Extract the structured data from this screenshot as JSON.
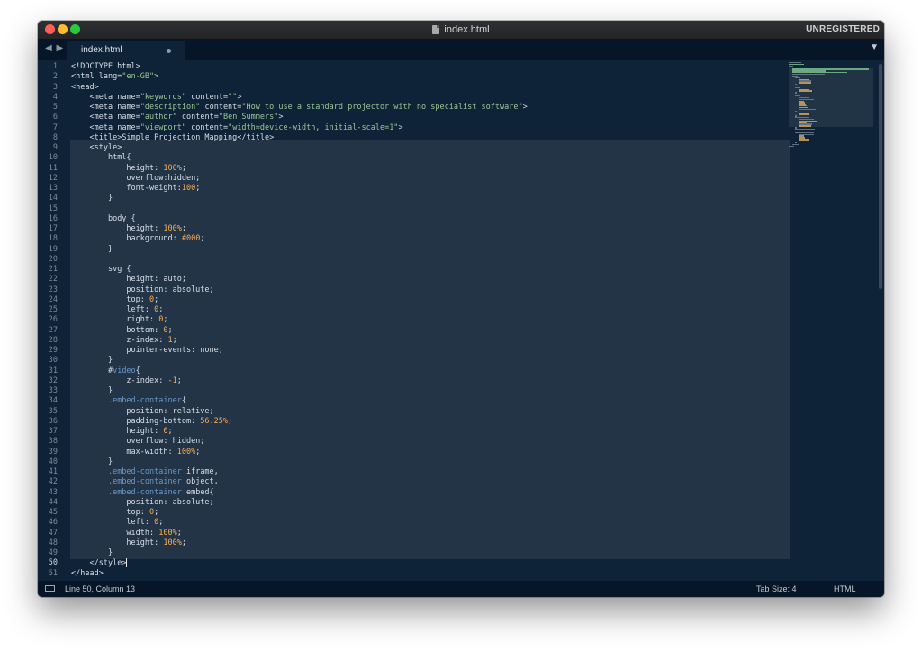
{
  "window": {
    "title": "index.html",
    "registration_status": "UNREGISTERED"
  },
  "tabs": [
    {
      "label": "index.html",
      "dirty": true
    }
  ],
  "icons": {
    "close": "close-icon",
    "minimize": "minimize-icon",
    "maximize": "maximize-icon",
    "document": "document-icon",
    "nav_arrows": "navigation-arrows-icon",
    "tab_menu": "chevron-down-icon",
    "panel": "panel-toggle-icon"
  },
  "nav_arrows": "◀ ▶",
  "tab_menu_glyph": "▼",
  "editor": {
    "active_line": 50,
    "lines": [
      [
        [
          "tag",
          "<!DOCTYPE html>"
        ]
      ],
      [
        [
          "tag",
          "<html "
        ],
        [
          "attr",
          "lang"
        ],
        [
          "tag",
          "="
        ],
        [
          "val",
          "\"en-GB\""
        ],
        [
          "tag",
          ">"
        ]
      ],
      [
        [
          "tag",
          "<head>"
        ]
      ],
      [
        [
          "text",
          "    "
        ],
        [
          "tag",
          "<meta "
        ],
        [
          "attr",
          "name"
        ],
        [
          "tag",
          "="
        ],
        [
          "val",
          "\"keywords\""
        ],
        [
          "tag",
          " "
        ],
        [
          "attr",
          "content"
        ],
        [
          "tag",
          "="
        ],
        [
          "val",
          "\"\""
        ],
        [
          "tag",
          ">"
        ]
      ],
      [
        [
          "text",
          "    "
        ],
        [
          "tag",
          "<meta "
        ],
        [
          "attr",
          "name"
        ],
        [
          "tag",
          "="
        ],
        [
          "val",
          "\"description\""
        ],
        [
          "tag",
          " "
        ],
        [
          "attr",
          "content"
        ],
        [
          "tag",
          "="
        ],
        [
          "val",
          "\"How to use a standard projector with no specialist software\""
        ],
        [
          "tag",
          ">"
        ]
      ],
      [
        [
          "text",
          "    "
        ],
        [
          "tag",
          "<meta "
        ],
        [
          "attr",
          "name"
        ],
        [
          "tag",
          "="
        ],
        [
          "val",
          "\"author\""
        ],
        [
          "tag",
          " "
        ],
        [
          "attr",
          "content"
        ],
        [
          "tag",
          "="
        ],
        [
          "val",
          "\"Ben Summers\""
        ],
        [
          "tag",
          ">"
        ]
      ],
      [
        [
          "text",
          "    "
        ],
        [
          "tag",
          "<meta "
        ],
        [
          "attr",
          "name"
        ],
        [
          "tag",
          "="
        ],
        [
          "val",
          "\"viewport\""
        ],
        [
          "tag",
          " "
        ],
        [
          "attr",
          "content"
        ],
        [
          "tag",
          "="
        ],
        [
          "val",
          "\"width=device-width, initial-scale=1\""
        ],
        [
          "tag",
          ">"
        ]
      ],
      [
        [
          "text",
          "    "
        ],
        [
          "tag",
          "<title>"
        ],
        [
          "text",
          "Simple Projection Mapping"
        ],
        [
          "tag",
          "</title>"
        ]
      ],
      [
        [
          "text",
          "    "
        ],
        [
          "tag",
          "<style>"
        ]
      ],
      [
        [
          "text",
          "        "
        ],
        [
          "prop",
          "html{"
        ]
      ],
      [
        [
          "text",
          "            "
        ],
        [
          "prop",
          "height: "
        ],
        [
          "num",
          "100%"
        ],
        [
          "prop",
          ";"
        ]
      ],
      [
        [
          "text",
          "            "
        ],
        [
          "prop",
          "overflow:hidden;"
        ]
      ],
      [
        [
          "text",
          "            "
        ],
        [
          "prop",
          "font-weight:"
        ],
        [
          "num",
          "100"
        ],
        [
          "prop",
          ";"
        ]
      ],
      [
        [
          "text",
          "        "
        ],
        [
          "prop",
          "}"
        ]
      ],
      [
        [
          "text",
          ""
        ]
      ],
      [
        [
          "text",
          "        "
        ],
        [
          "prop",
          "body {"
        ]
      ],
      [
        [
          "text",
          "            "
        ],
        [
          "prop",
          "height: "
        ],
        [
          "num",
          "100%"
        ],
        [
          "prop",
          ";"
        ]
      ],
      [
        [
          "text",
          "            "
        ],
        [
          "prop",
          "background: "
        ],
        [
          "num",
          "#000"
        ],
        [
          "prop",
          ";"
        ]
      ],
      [
        [
          "text",
          "        "
        ],
        [
          "prop",
          "}"
        ]
      ],
      [
        [
          "text",
          ""
        ]
      ],
      [
        [
          "text",
          "        "
        ],
        [
          "prop",
          "svg {"
        ]
      ],
      [
        [
          "text",
          "            "
        ],
        [
          "prop",
          "height: auto;"
        ]
      ],
      [
        [
          "text",
          "            "
        ],
        [
          "prop",
          "position: absolute;"
        ]
      ],
      [
        [
          "text",
          "            "
        ],
        [
          "prop",
          "top: "
        ],
        [
          "num",
          "0"
        ],
        [
          "prop",
          ";"
        ]
      ],
      [
        [
          "text",
          "            "
        ],
        [
          "prop",
          "left: "
        ],
        [
          "num",
          "0"
        ],
        [
          "prop",
          ";"
        ]
      ],
      [
        [
          "text",
          "            "
        ],
        [
          "prop",
          "right: "
        ],
        [
          "num",
          "0"
        ],
        [
          "prop",
          ";"
        ]
      ],
      [
        [
          "text",
          "            "
        ],
        [
          "prop",
          "bottom: "
        ],
        [
          "num",
          "0"
        ],
        [
          "prop",
          ";"
        ]
      ],
      [
        [
          "text",
          "            "
        ],
        [
          "prop",
          "z-index: "
        ],
        [
          "num",
          "1"
        ],
        [
          "prop",
          ";"
        ]
      ],
      [
        [
          "text",
          "            "
        ],
        [
          "prop",
          "pointer-events: none;"
        ]
      ],
      [
        [
          "text",
          "        "
        ],
        [
          "prop",
          "}"
        ]
      ],
      [
        [
          "text",
          "        "
        ],
        [
          "prop",
          "#"
        ],
        [
          "sel",
          "video"
        ],
        [
          "prop",
          "{"
        ]
      ],
      [
        [
          "text",
          "            "
        ],
        [
          "prop",
          "z-index: "
        ],
        [
          "num",
          "-1"
        ],
        [
          "prop",
          ";"
        ]
      ],
      [
        [
          "text",
          "        "
        ],
        [
          "prop",
          "}"
        ]
      ],
      [
        [
          "text",
          "        "
        ],
        [
          "sel",
          ".embed-container"
        ],
        [
          "prop",
          "{"
        ]
      ],
      [
        [
          "text",
          "            "
        ],
        [
          "prop",
          "position: relative;"
        ]
      ],
      [
        [
          "text",
          "            "
        ],
        [
          "prop",
          "padding-bottom: "
        ],
        [
          "num",
          "56.25%"
        ],
        [
          "prop",
          ";"
        ]
      ],
      [
        [
          "text",
          "            "
        ],
        [
          "prop",
          "height: "
        ],
        [
          "num",
          "0"
        ],
        [
          "prop",
          ";"
        ]
      ],
      [
        [
          "text",
          "            "
        ],
        [
          "prop",
          "overflow: hidden;"
        ]
      ],
      [
        [
          "text",
          "            "
        ],
        [
          "prop",
          "max-width: "
        ],
        [
          "num",
          "100%"
        ],
        [
          "prop",
          ";"
        ]
      ],
      [
        [
          "text",
          "        "
        ],
        [
          "prop",
          "}"
        ]
      ],
      [
        [
          "text",
          "        "
        ],
        [
          "sel",
          ".embed-container"
        ],
        [
          "prop",
          " iframe,"
        ]
      ],
      [
        [
          "text",
          "        "
        ],
        [
          "sel",
          ".embed-container"
        ],
        [
          "prop",
          " object,"
        ]
      ],
      [
        [
          "text",
          "        "
        ],
        [
          "sel",
          ".embed-container"
        ],
        [
          "prop",
          " embed{"
        ]
      ],
      [
        [
          "text",
          "            "
        ],
        [
          "prop",
          "position: absolute;"
        ]
      ],
      [
        [
          "text",
          "            "
        ],
        [
          "prop",
          "top: "
        ],
        [
          "num",
          "0"
        ],
        [
          "prop",
          ";"
        ]
      ],
      [
        [
          "text",
          "            "
        ],
        [
          "prop",
          "left: "
        ],
        [
          "num",
          "0"
        ],
        [
          "prop",
          ";"
        ]
      ],
      [
        [
          "text",
          "            "
        ],
        [
          "prop",
          "width: "
        ],
        [
          "num",
          "100%"
        ],
        [
          "prop",
          ";"
        ]
      ],
      [
        [
          "text",
          "            "
        ],
        [
          "prop",
          "height: "
        ],
        [
          "num",
          "100%"
        ],
        [
          "prop",
          ";"
        ]
      ],
      [
        [
          "text",
          "        "
        ],
        [
          "prop",
          "}"
        ]
      ],
      [
        [
          "text",
          "    "
        ],
        [
          "tag",
          "</style>"
        ]
      ],
      [
        [
          "tag",
          "</head>"
        ]
      ]
    ]
  },
  "status": {
    "position": "Line 50, Column 13",
    "tab_size": "Tab Size: 4",
    "syntax": "HTML"
  }
}
